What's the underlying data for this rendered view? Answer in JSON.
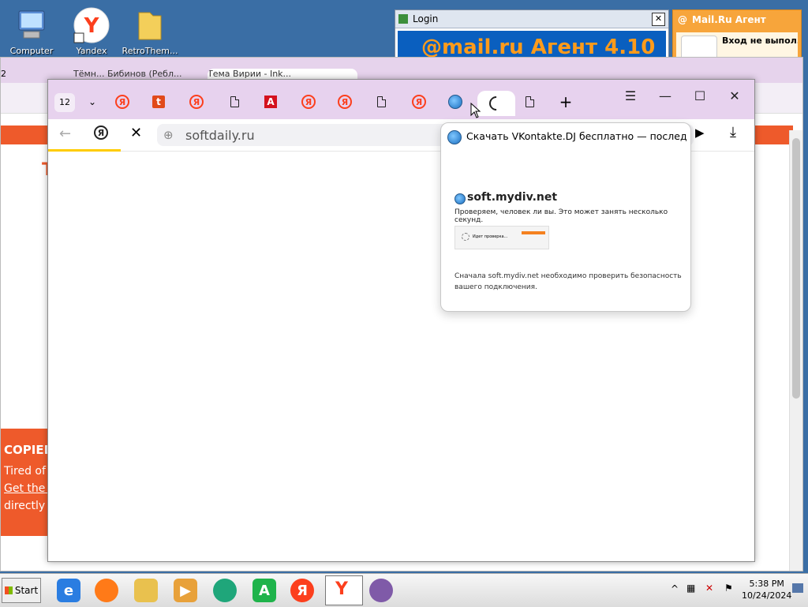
{
  "desktop": {
    "icons": [
      {
        "label": "Computer"
      },
      {
        "label": "Yandex"
      },
      {
        "label": "RetroThem..."
      }
    ]
  },
  "login_window": {
    "title": "Login",
    "banner_text": "@mail.ru Агент 4.10",
    "close_label": "✕"
  },
  "agent_window": {
    "title": "Mail.Ru Агент",
    "status": "Вход не выпол..."
  },
  "bg_browser": {
    "tab_count": "2",
    "tab_titles": [
      "Тёмн... Бибинов (Ребл...",
      "Тема Вирии - Ink..."
    ],
    "cookie_title": "COPIED",
    "cookie_line1": "Tired of c",
    "cookie_link": "Get the F",
    "cookie_line2": "directly in",
    "heading_letter": "T"
  },
  "fg_browser": {
    "tab_count": "12",
    "tabs": [
      {
        "icon": "yandex-icon"
      },
      {
        "icon": "t-icon"
      },
      {
        "icon": "yandex-icon"
      },
      {
        "icon": "document-icon"
      },
      {
        "icon": "a-icon"
      },
      {
        "icon": "yandex-icon"
      },
      {
        "icon": "yandex-icon"
      },
      {
        "icon": "document-icon"
      },
      {
        "icon": "yandex-icon"
      },
      {
        "icon": "globe-icon"
      },
      {
        "icon": "loading-icon"
      },
      {
        "icon": "document-icon"
      }
    ],
    "new_tab_label": "+",
    "address": "softdaily.ru",
    "window_controls": {
      "menu": "☰",
      "minimize": "—",
      "maximize": "☐",
      "close": "✕"
    }
  },
  "tab_preview": {
    "title": "Скачать VKontakte.DJ бесплатно — последня...",
    "site_name": "soft.mydiv.net",
    "check_text": "Проверяем, человек ли вы. Это может занять несколько секунд.",
    "cf_label": "Идет проверка...",
    "note": "Сначала soft.mydiv.net необходимо проверить безопасность вашего подключения."
  },
  "taskbar": {
    "start_label": "Start",
    "time": "5:38 PM",
    "date": "10/24/2024"
  },
  "colors": {
    "accent_orange": "#ee5a2b",
    "yandex_red": "#fc3f1d",
    "tabbar_purple": "#e7d2ee"
  }
}
